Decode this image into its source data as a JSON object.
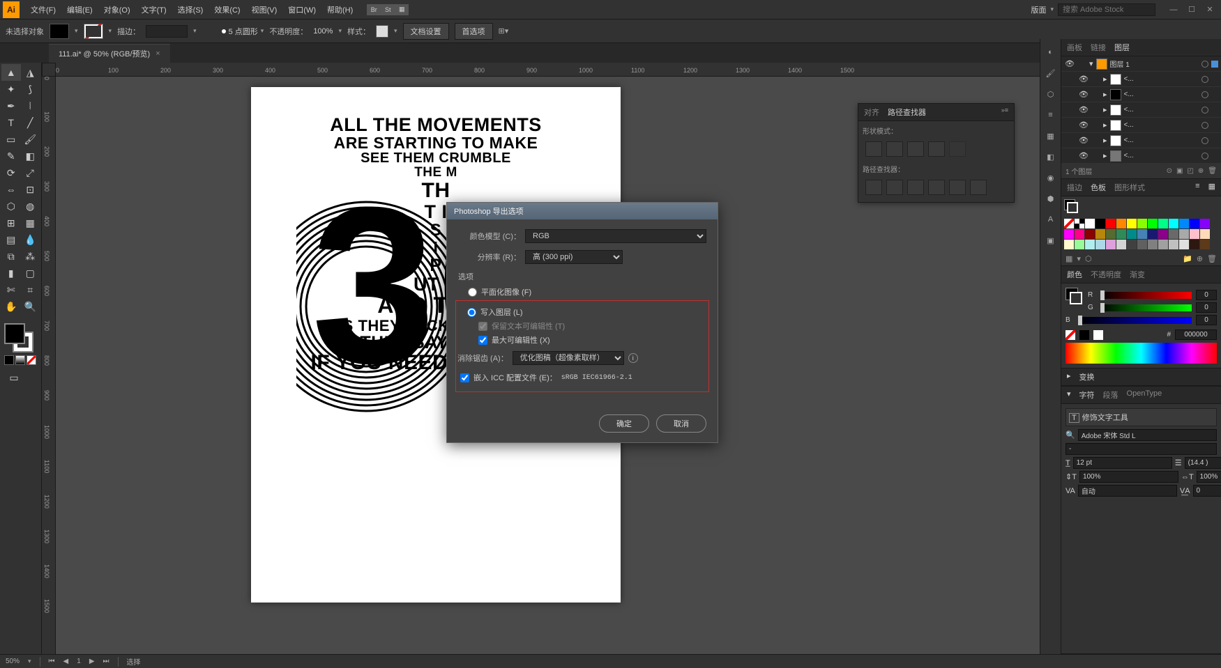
{
  "app": {
    "icon": "Ai"
  },
  "menu": [
    "文件(F)",
    "编辑(E)",
    "对象(O)",
    "文字(T)",
    "选择(S)",
    "效果(C)",
    "视图(V)",
    "窗口(W)",
    "帮助(H)"
  ],
  "menu_right": {
    "layout_label": "版面",
    "search_placeholder": "搜索 Adobe Stock"
  },
  "options": {
    "selection": "未选择对象",
    "stroke_label": "描边：",
    "stroke_weight": "",
    "point_style": "5 点圆形",
    "opacity_label": "不透明度：",
    "opacity": "100%",
    "style_label": "样式：",
    "doc_setup": "文档设置",
    "prefs": "首选项"
  },
  "tab": {
    "title": "111.ai* @ 50% (RGB/预览)"
  },
  "artboard": {
    "lines": [
      {
        "t": "ALL THE MOVEMENTS",
        "s": 27
      },
      {
        "t": "ARE STARTING TO MAKE",
        "s": 23
      },
      {
        "t": "SEE THEM CRUMBLE",
        "s": 20
      },
      {
        "t": "THE M",
        "s": 19
      },
      {
        "t": "TH",
        "s": 30
      },
      {
        "t": "T I",
        "s": 27
      },
      {
        "t": "S",
        "s": 24
      },
      {
        "t": "I",
        "s": 23
      },
      {
        "t": "P",
        "s": 25
      },
      {
        "t": "UT A",
        "s": 27
      },
      {
        "t": "AND THEY",
        "s": 32
      },
      {
        "t": "AS THEY BECKON YOU ON",
        "s": 22
      },
      {
        "t": "THEY SAY START",
        "s": 25
      },
      {
        "t": "IF YOU NEED TO GO ON",
        "s": 30
      }
    ]
  },
  "dialog": {
    "title": "Photoshop 导出选项",
    "color_model_label": "颜色模型 (C)：",
    "color_model": "RGB",
    "resolution_label": "分辨率 (R)：",
    "resolution": "高 (300 ppi)",
    "options_label": "选项",
    "flat_image": "平面化图像 (F)",
    "write_layers": "写入图层 (L)",
    "keep_text": "保留文本可编辑性 (T)",
    "max_edit": "最大可编辑性 (X)",
    "antialias_label": "消除锯齿 (A)：",
    "antialias": "优化图稿（超像素取样）",
    "embed_icc": "嵌入 ICC 配置文件 (E)：",
    "icc_profile": "sRGB IEC61966-2.1",
    "ok": "确定",
    "cancel": "取消"
  },
  "align_panel": {
    "tabs": [
      "对齐",
      "路径查找器"
    ],
    "shape_label": "形状模式：",
    "path_label": "路径查找器："
  },
  "layers_panel": {
    "tabs": [
      "画板",
      "链接",
      "图层"
    ],
    "items": [
      {
        "name": "图层 1",
        "fill": "#ff9a00"
      },
      {
        "name": "<...",
        "fill": "#fff"
      },
      {
        "name": "<...",
        "fill": "#000"
      },
      {
        "name": "<...",
        "fill": "#fff"
      },
      {
        "name": "<...",
        "fill": "#fff"
      },
      {
        "name": "<...",
        "fill": "#fff"
      },
      {
        "name": "<...",
        "fill": "#777"
      }
    ],
    "footer": "1 个图层"
  },
  "swatch_panel": {
    "tabs": [
      "描边",
      "色板",
      "图形样式"
    ]
  },
  "color_panel": {
    "tabs": [
      "颜色",
      "不透明度",
      "渐变"
    ],
    "r": 0,
    "g": 0,
    "b": 0,
    "hex": "000000"
  },
  "transform_panel": {
    "title": "变换"
  },
  "char_panel": {
    "tabs": [
      "字符",
      "段落",
      "OpenType"
    ],
    "touch_type": "修饰文字工具",
    "font": "Adobe 宋体 Std L",
    "size": "12 pt",
    "leading": "(14.4 )",
    "pct1": "100%",
    "pct2": "100%",
    "tracking": "自动",
    "kerning": "0"
  },
  "status": {
    "zoom": "50%",
    "artboard_nav": "1",
    "tool": "选择"
  },
  "ruler_h": [
    "0",
    "100",
    "200",
    "300",
    "400",
    "500",
    "600",
    "700",
    "800",
    "900",
    "1000",
    "1100",
    "1200",
    "1300",
    "1400",
    "1500"
  ],
  "ruler_v": [
    "0",
    "100",
    "200",
    "300",
    "400",
    "500",
    "600",
    "700",
    "800",
    "900",
    "1000",
    "1100",
    "1200",
    "1300",
    "1400",
    "1500"
  ]
}
